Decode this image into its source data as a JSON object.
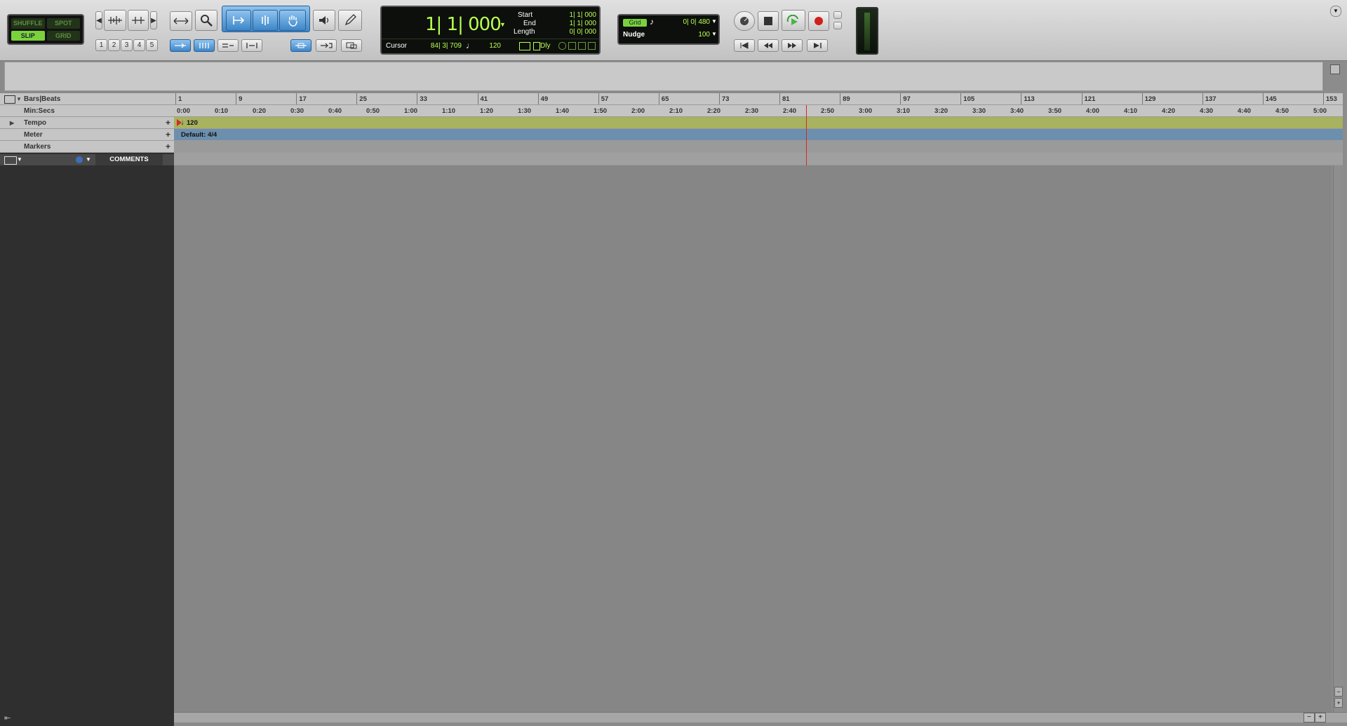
{
  "edit_modes": {
    "shuffle": "SHUFFLE",
    "spot": "SPOT",
    "slip": "SLIP",
    "grid": "GRID"
  },
  "zoom_presets": [
    "1",
    "2",
    "3",
    "4",
    "5"
  ],
  "counter": {
    "main": "1| 1| 000",
    "start_label": "Start",
    "start_value": "1| 1| 000",
    "end_label": "End",
    "end_value": "1| 1| 000",
    "length_label": "Length",
    "length_value": "0| 0| 000",
    "cursor_label": "Cursor",
    "cursor_value": "84| 3| 709",
    "tempo_value": "120",
    "dly_label": "Dly"
  },
  "grid": {
    "grid_label": "Grid",
    "grid_value": "0| 0| 480",
    "nudge_label": "Nudge",
    "nudge_value": "100"
  },
  "rulers": [
    {
      "name": "Bars|Beats",
      "expand": false,
      "add": false
    },
    {
      "name": "Min:Secs",
      "expand": false,
      "add": false
    },
    {
      "name": "Tempo",
      "expand": true,
      "add": true
    },
    {
      "name": "Meter",
      "expand": false,
      "add": true
    },
    {
      "name": "Markers",
      "expand": false,
      "add": true
    }
  ],
  "bars_ticks": [
    "1",
    "9",
    "17",
    "25",
    "33",
    "41",
    "49",
    "57",
    "65",
    "73",
    "81",
    "89",
    "97",
    "105",
    "113",
    "121",
    "129",
    "137",
    "145",
    "153"
  ],
  "time_ticks": [
    "0:00",
    "0:10",
    "0:20",
    "0:30",
    "0:40",
    "0:50",
    "1:00",
    "1:10",
    "1:20",
    "1:30",
    "1:40",
    "1:50",
    "2:00",
    "2:10",
    "2:20",
    "2:30",
    "2:40",
    "2:50",
    "3:00",
    "3:10",
    "3:20",
    "3:30",
    "3:40",
    "3:50",
    "4:00",
    "4:10",
    "4:20",
    "4:30",
    "4:40",
    "4:50",
    "5:00"
  ],
  "tempo_marker": "120",
  "meter_default": "Default: 4/4",
  "comments_header": "COMMENTS",
  "colors": {
    "tempo": "#a8b25f",
    "meter": "#6d8fae",
    "playhead": "#d52a20"
  }
}
